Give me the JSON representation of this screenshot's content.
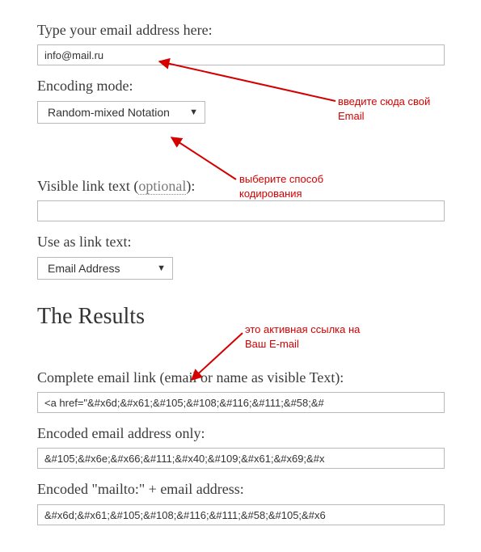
{
  "email": {
    "label": "Type your email address here:",
    "value": "info@mail.ru"
  },
  "encoding": {
    "label": "Encoding mode:",
    "selected": "Random-mixed Notation"
  },
  "visibleText": {
    "label_pre": "Visible link text (",
    "label_opt": "optional",
    "label_post": "):",
    "value": ""
  },
  "useAs": {
    "label": "Use as link text:",
    "selected": "Email Address"
  },
  "results": {
    "heading": "The Results",
    "completeLabel": "Complete email link (email or name as visible Text):",
    "completeValue": "<a href=\"&#x6d;&#x61;&#105;&#108;&#116;&#111;&#58;&#",
    "encodedAddrLabel": "Encoded email address only:",
    "encodedAddrValue": "&#105;&#x6e;&#x66;&#111;&#x40;&#109;&#x61;&#x69;&#x",
    "encodedMailtoLabel": "Encoded \"mailto:\" + email address:",
    "encodedMailtoValue": "&#x6d;&#x61;&#105;&#108;&#116;&#111;&#58;&#105;&#x6"
  },
  "annotations": {
    "a1": "введите сюда свой\nEmail",
    "a2": "выберите способ\nкодирования",
    "a3": "это активная ссылка на\nВаш E-mail"
  }
}
